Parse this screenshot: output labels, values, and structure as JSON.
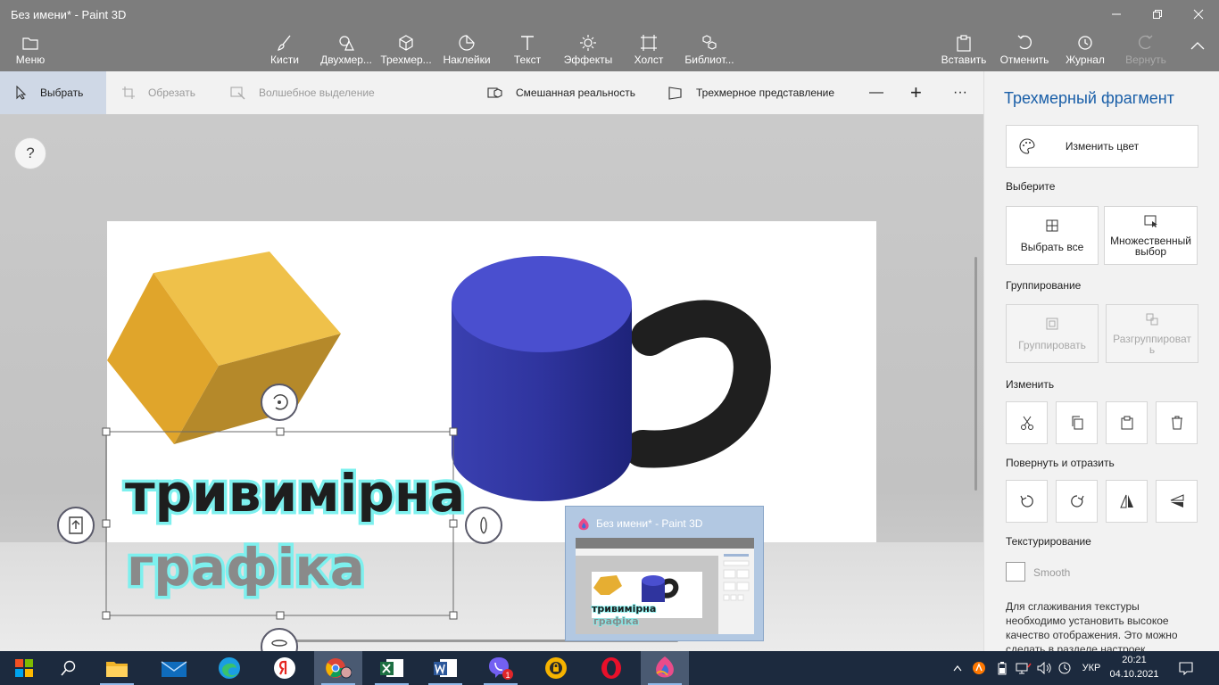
{
  "window": {
    "title": "Без имени* - Paint 3D"
  },
  "ribbon": {
    "menu": "Меню",
    "tools": [
      {
        "label": "Кисти",
        "icon": "brush-icon"
      },
      {
        "label": "Двухмер...",
        "icon": "shapes-2d-icon"
      },
      {
        "label": "Трехмер...",
        "icon": "shapes-3d-icon"
      },
      {
        "label": "Наклейки",
        "icon": "sticker-icon"
      },
      {
        "label": "Текст",
        "icon": "text-icon"
      },
      {
        "label": "Эффекты",
        "icon": "effects-icon"
      },
      {
        "label": "Холст",
        "icon": "canvas-icon"
      },
      {
        "label": "Библиот...",
        "icon": "library-icon"
      }
    ],
    "paste": "Вставить",
    "undo": "Отменить",
    "history": "Журнал",
    "redo": "Вернуть"
  },
  "toolbar": {
    "select": "Выбрать",
    "crop": "Обрезать",
    "magic_select": "Волшебное выделение",
    "mixed_reality": "Смешанная реальность",
    "view_3d": "Трехмерное представление",
    "zoom_out": "—",
    "zoom_in": "+",
    "more": "···"
  },
  "canvas": {
    "help": "?",
    "text_line1": "тривимірна",
    "text_line2": "графіка"
  },
  "panel": {
    "title": "Трехмерный фрагмент",
    "change_color": "Изменить цвет",
    "select_heading": "Выберите",
    "select_all": "Выбрать все",
    "multi_select_1": "Множественный",
    "multi_select_2": "выбор",
    "group_heading": "Группирование",
    "group": "Группировать",
    "ungroup_1": "Разгруппироват",
    "ungroup_2": "ь",
    "edit_heading": "Изменить",
    "rotate_heading": "Повернуть и отразить",
    "texture_heading": "Текстурирование",
    "smooth": "Smooth",
    "note": "Для сглаживания текстуры необходимо установить высокое качество отображения. Это можно сделать в разделе настроек"
  },
  "preview": {
    "title": "Без имени* - Paint 3D"
  },
  "taskbar": {
    "apps": [
      "start-icon",
      "search-icon",
      "file-explorer-icon",
      "mail-icon",
      "edge-icon",
      "yandex-icon",
      "chrome-icon",
      "excel-icon",
      "word-icon",
      "viber-icon",
      "vpn-icon",
      "opera-icon",
      "paint3d-icon"
    ],
    "viber_badge": "1",
    "lang": "УКР",
    "time": "20:21",
    "date": "04.10.2021"
  },
  "colors": {
    "accent": "#1a5fa8",
    "chrome": "#7d7d7d",
    "taskbar": "#1c2a3e",
    "cube": "#e8b030",
    "cylinder": "#3d42b8",
    "handle": "#2a2a2a"
  }
}
